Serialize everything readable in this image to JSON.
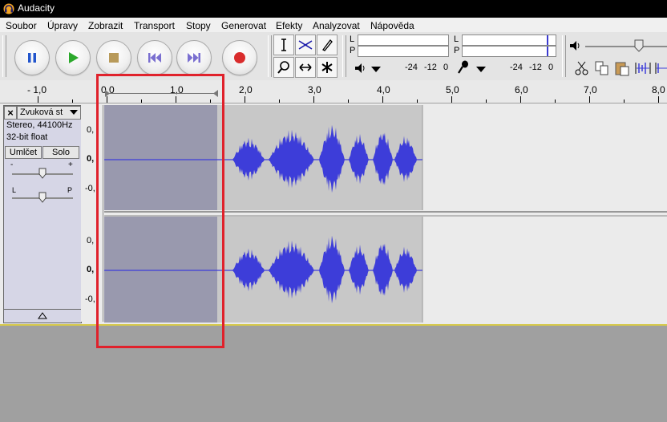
{
  "window": {
    "title": "Audacity"
  },
  "menu": {
    "items": [
      "Soubor",
      "Úpravy",
      "Zobrazit",
      "Transport",
      "Stopy",
      "Generovat",
      "Efekty",
      "Analyzovat",
      "Nápověda"
    ]
  },
  "meters": {
    "play": {
      "left_letter": "L",
      "right_letter": "P"
    },
    "rec": {
      "left_letter": "L",
      "right_letter": "P"
    },
    "scale_play": [
      "-24",
      "-12",
      "0"
    ],
    "scale_rec": [
      "-24",
      "-12",
      "0"
    ]
  },
  "ruler": {
    "labels": [
      "- 1,0",
      "0,0",
      "1,0",
      "2,0",
      "3,0",
      "4,0",
      "5,0",
      "6,0",
      "7,0",
      "8,0"
    ]
  },
  "track": {
    "name": "Zvuková st",
    "format_line1": "Stereo, 44100Hz",
    "format_line2": "32-bit float",
    "mute_label": "Umlčet",
    "solo_label": "Solo",
    "gain_minus": "-",
    "gain_plus": "+",
    "pan_left": "L",
    "pan_right": "P",
    "scale_top": "0,",
    "scale_mid": "0,",
    "scale_bottom": "-0,"
  },
  "colors": {
    "waveform": "#3d3dd9",
    "selection": "#9999ae",
    "highlight_box": "#e0212b",
    "audio_region": "#c8c8c8",
    "record_red": "#d92c2c",
    "play_green": "#2ba82b"
  }
}
